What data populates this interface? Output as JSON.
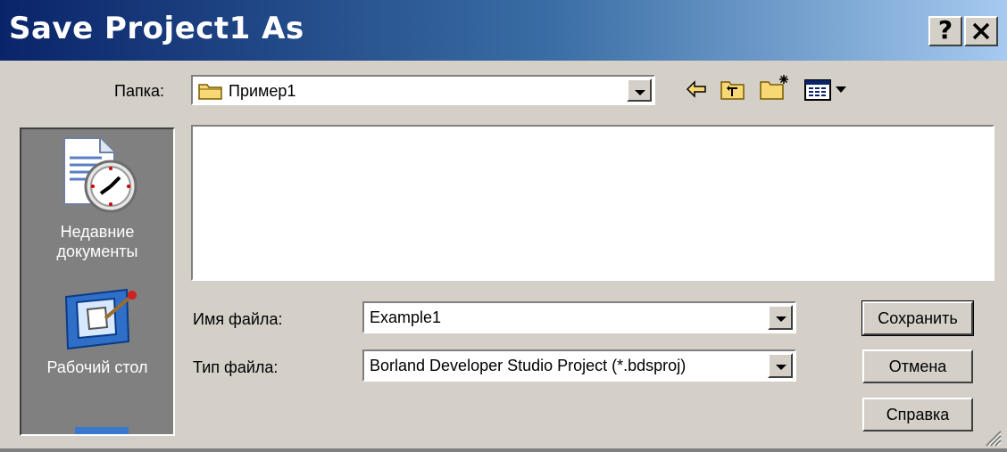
{
  "title": "Save Project1 As",
  "title_buttons": {
    "help": "?",
    "close": "✕"
  },
  "folder": {
    "label": "Папка:",
    "value": "Пример1"
  },
  "toolbar": {
    "back_icon": "back-arrow-icon",
    "up_icon": "up-folder-icon",
    "new_folder_icon": "new-folder-icon",
    "view_icon": "view-menu-icon"
  },
  "places": [
    {
      "label_line1": "Недавние",
      "label_line2": "документы",
      "icon": "recent-documents-icon"
    },
    {
      "label_line1": "Рабочий стол",
      "label_line2": "",
      "icon": "desktop-icon"
    }
  ],
  "filename": {
    "label": "Имя файла:",
    "value": "Example1"
  },
  "filetype": {
    "label": "Тип файла:",
    "value": "Borland Developer Studio Project (*.bdsproj)"
  },
  "buttons": {
    "save": "Сохранить",
    "cancel": "Отмена",
    "help": "Справка"
  },
  "colors": {
    "title_start": "#0a246a",
    "title_end": "#a6caf0",
    "dialog_bg": "#d4d0c8",
    "places_bg": "#808080"
  }
}
